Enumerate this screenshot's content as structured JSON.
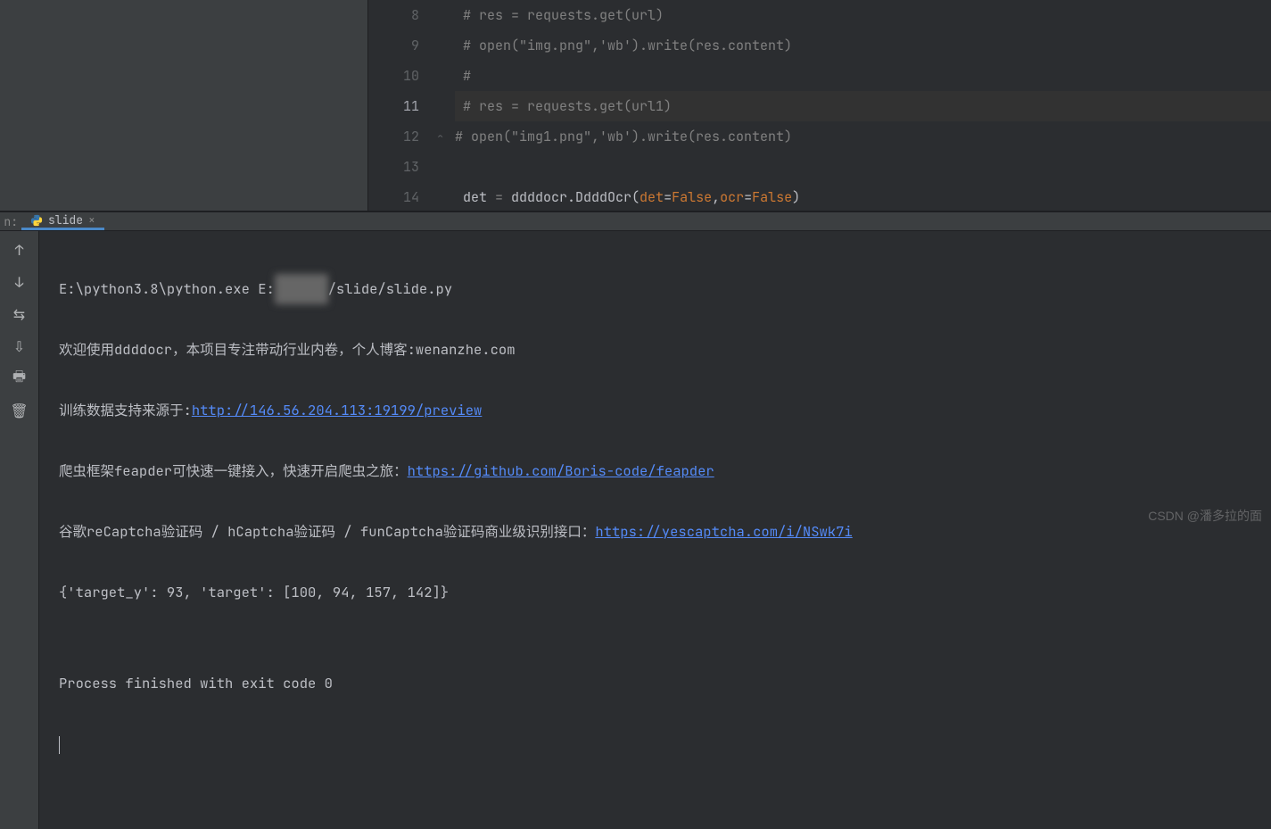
{
  "editor": {
    "lines": [
      {
        "num": 8,
        "text": " # res = requests.get(url)"
      },
      {
        "num": 9,
        "text": " # open(\"img.png\",'wb').write(res.content)"
      },
      {
        "num": 10,
        "text": " #"
      },
      {
        "num": 11,
        "text": " # res = requests.get(url1)",
        "active": true
      },
      {
        "num": 12,
        "text": "# open(\"img1.png\",'wb').write(res.content)",
        "fold": true
      },
      {
        "num": 13,
        "text": ""
      },
      {
        "num": 14,
        "code_segments": [
          {
            "t": " det ",
            "cls": "ident"
          },
          {
            "t": "=",
            "cls": ""
          },
          {
            "t": " ddddocr.DdddOcr(",
            "cls": "ident"
          },
          {
            "t": "det",
            "cls": "kw-param"
          },
          {
            "t": "=",
            "cls": "ident"
          },
          {
            "t": "False",
            "cls": "kw-param"
          },
          {
            "t": ",",
            "cls": "ident"
          },
          {
            "t": "ocr",
            "cls": "kw-param"
          },
          {
            "t": "=",
            "cls": "ident"
          },
          {
            "t": "False",
            "cls": "kw-param"
          },
          {
            "t": ")",
            "cls": "ident"
          }
        ]
      }
    ]
  },
  "run_tab": {
    "left_label": "n:",
    "name": "slide",
    "close": "×"
  },
  "tool_icons": {
    "up": "↑",
    "down": "↓",
    "wrap": "⇆",
    "scroll": "⇩",
    "print": "🖶",
    "delete": "🗑"
  },
  "console": {
    "line1_a": "E:\\python3.8\\python.exe E:",
    "line1_blur": "xxxxxx",
    "line1_b": "/slide/slide.py",
    "line2": "欢迎使用ddddocr，本项目专注带动行业内卷，个人博客:wenanzhe.com",
    "line3_a": "训练数据支持来源于:",
    "line3_link": "http://146.56.204.113:19199/preview",
    "line4_a": "爬虫框架feapder可快速一键接入，快速开启爬虫之旅：",
    "line4_link": "https://github.com/Boris-code/feapder",
    "line5_a": "谷歌reCaptcha验证码 / hCaptcha验证码 / funCaptcha验证码商业级识别接口：",
    "line5_link": "https://yescaptcha.com/i/NSwk7i",
    "line6": "{'target_y': 93, 'target': [100, 94, 157, 142]}",
    "line7": "",
    "line8": "Process finished with exit code 0"
  },
  "watermark": "CSDN @潘多拉的面"
}
